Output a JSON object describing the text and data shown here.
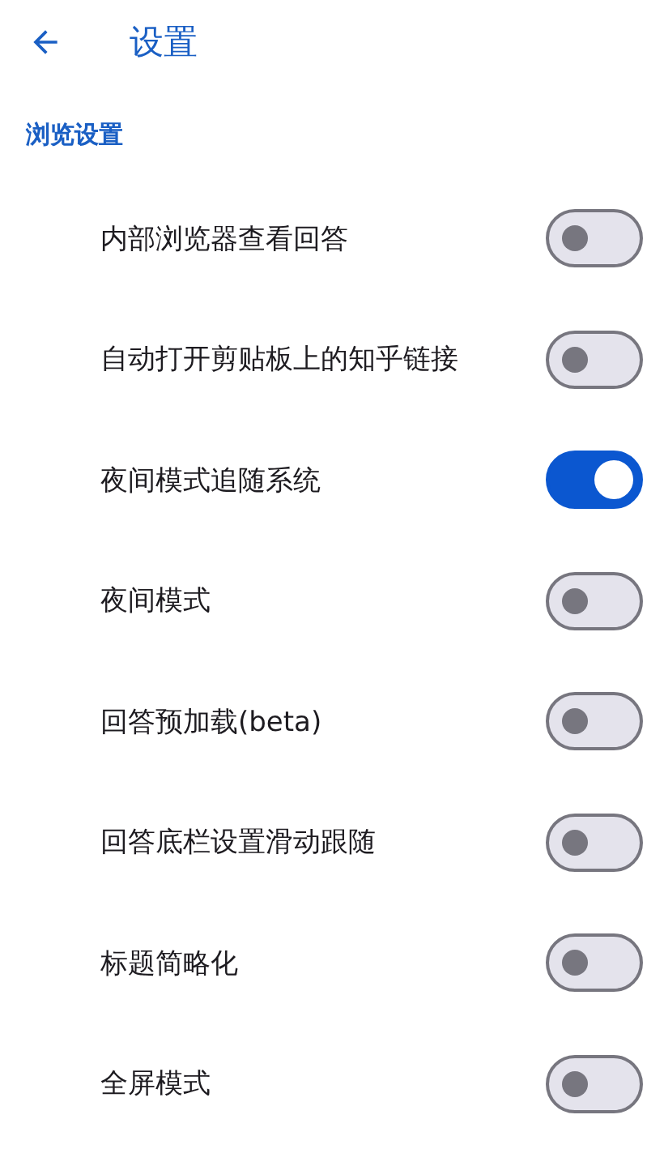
{
  "header": {
    "title": "设置"
  },
  "section": {
    "title": "浏览设置"
  },
  "settings": [
    {
      "label": "内部浏览器查看回答",
      "on": false
    },
    {
      "label": "自动打开剪贴板上的知乎链接",
      "on": false
    },
    {
      "label": "夜间模式追随系统",
      "on": true
    },
    {
      "label": "夜间模式",
      "on": false
    },
    {
      "label": "回答预加载(beta)",
      "on": false
    },
    {
      "label": "回答底栏设置滑动跟随",
      "on": false
    },
    {
      "label": "标题简略化",
      "on": false
    },
    {
      "label": "全屏模式",
      "on": false
    }
  ]
}
